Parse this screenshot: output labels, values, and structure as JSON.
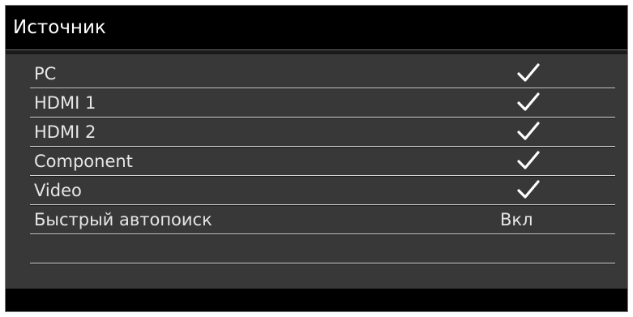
{
  "window": {
    "title": "Источник"
  },
  "menu": {
    "items": [
      {
        "label": "PC",
        "type": "checkbox",
        "checked": true
      },
      {
        "label": "HDMI 1",
        "type": "checkbox",
        "checked": true
      },
      {
        "label": "HDMI 2",
        "type": "checkbox",
        "checked": true
      },
      {
        "label": "Component",
        "type": "checkbox",
        "checked": true
      },
      {
        "label": "Video",
        "type": "checkbox",
        "checked": true
      },
      {
        "label": "Быстрый автопоиск",
        "type": "value",
        "value": "Вкл"
      }
    ],
    "empty_rows": 1
  },
  "colors": {
    "panel_background": "#383838",
    "title_background": "#000000",
    "text": "#e6e6e6",
    "divider": "#d6d6d6"
  },
  "icons": {
    "check": "check-icon"
  }
}
